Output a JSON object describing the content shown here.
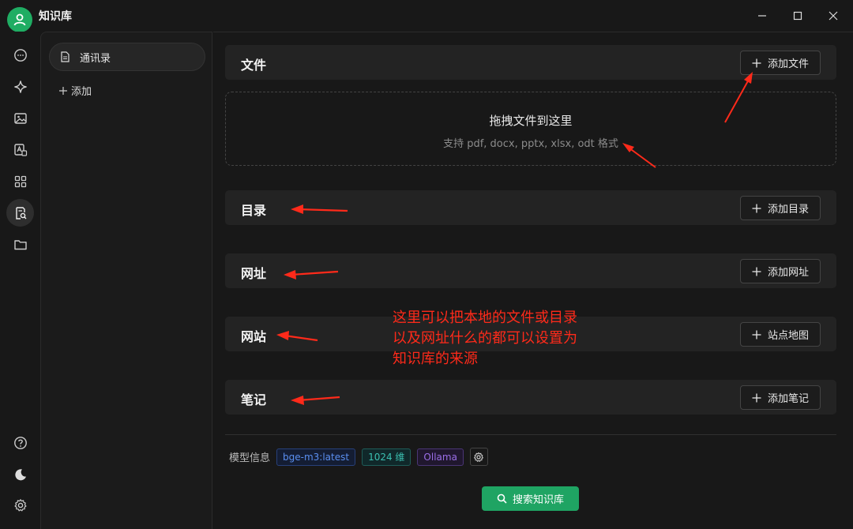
{
  "window": {
    "title": "知识库"
  },
  "rail": {
    "items": [
      {
        "icon": "chat-icon"
      },
      {
        "icon": "sparkle-icon"
      },
      {
        "icon": "image-icon"
      },
      {
        "icon": "translate-icon"
      },
      {
        "icon": "apps-icon"
      },
      {
        "icon": "knowledge-icon",
        "active": true
      },
      {
        "icon": "folder-icon"
      }
    ],
    "bottom": [
      {
        "icon": "help-icon"
      },
      {
        "icon": "moon-icon"
      },
      {
        "icon": "settings-icon"
      }
    ]
  },
  "sidebar": {
    "kb_name": "通讯录",
    "add_label": "添加"
  },
  "sections": {
    "file": {
      "title": "文件",
      "button": "添加文件"
    },
    "dir": {
      "title": "目录",
      "button": "添加目录"
    },
    "url": {
      "title": "网址",
      "button": "添加网址"
    },
    "site": {
      "title": "网站",
      "button": "站点地图"
    },
    "note": {
      "title": "笔记",
      "button": "添加笔记"
    }
  },
  "dropzone": {
    "title": "拖拽文件到这里",
    "hint": "支持 pdf, docx, pptx, xlsx, odt 格式"
  },
  "model": {
    "label": "模型信息",
    "name": "bge-m3:latest",
    "dims": "1024 维",
    "provider": "Ollama"
  },
  "search_button": "搜索知识库",
  "annotation": "这里可以把本地的文件或目录\n以及网址什么的都可以设置为\n知识库的来源",
  "colors": {
    "accent": "#1fa463",
    "annotation": "#ff2a1a"
  }
}
